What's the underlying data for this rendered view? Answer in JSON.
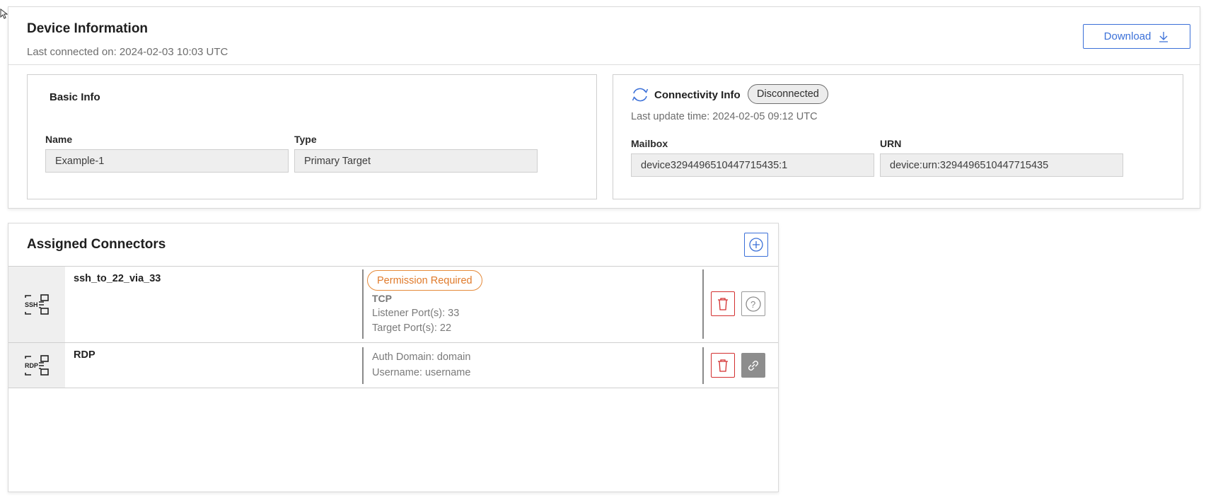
{
  "device": {
    "title": "Device Information",
    "last_connected": "Last connected on: 2024-02-03 10:03 UTC",
    "download_label": "Download"
  },
  "basic_info": {
    "title": "Basic Info",
    "name_label": "Name",
    "name_value": "Example-1",
    "type_label": "Type",
    "type_value": "Primary Target"
  },
  "connectivity": {
    "title": "Connectivity Info",
    "status": "Disconnected",
    "last_update": "Last update time: 2024-02-05 09:12 UTC",
    "mailbox_label": "Mailbox",
    "mailbox_value": "device3294496510447715435:1",
    "urn_label": "URN",
    "urn_value": "device:urn:3294496510447715435"
  },
  "connectors": {
    "title": "Assigned Connectors",
    "items": [
      {
        "name": "ssh_to_22_via_33",
        "icon": "ssh-connector-icon",
        "badge": "Permission Required",
        "protocol": "TCP",
        "listener": "Listener Port(s): 33",
        "target": "Target Port(s): 22"
      },
      {
        "name": "RDP",
        "icon": "rdp-connector-icon",
        "auth_domain": "Auth Domain: domain",
        "username": "Username: username"
      }
    ]
  },
  "colors": {
    "accent": "#3b70d8",
    "warning": "#e07a2a",
    "danger": "#d32f2f"
  }
}
